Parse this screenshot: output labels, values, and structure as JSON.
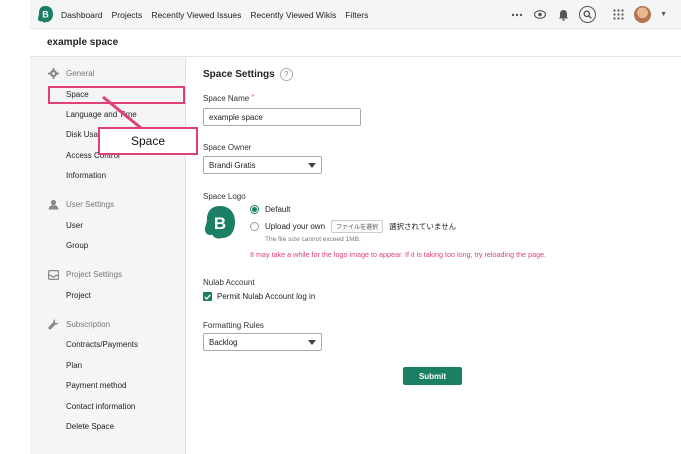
{
  "nav": {
    "items": [
      "Dashboard",
      "Projects",
      "Recently Viewed Issues",
      "Recently Viewed Wikis",
      "Filters"
    ],
    "icons": [
      "more-icon",
      "watch-icon",
      "bell-icon",
      "search-icon",
      "apps-grid-icon",
      "avatar"
    ]
  },
  "space_title": "example space",
  "sidebar": {
    "sections": [
      {
        "title": "General",
        "icon": "gear-icon",
        "items": [
          "Space",
          "Language and Time",
          "Disk Usage",
          "Access Control",
          "Information"
        ]
      },
      {
        "title": "User Settings",
        "icon": "users-icon",
        "items": [
          "User",
          "Group"
        ]
      },
      {
        "title": "Project Settings",
        "icon": "inbox-icon",
        "items": [
          "Project"
        ]
      },
      {
        "title": "Subscription",
        "icon": "wrench-icon",
        "items": [
          "Contracts/Payments",
          "Plan",
          "Payment method",
          "Contact information",
          "Delete Space"
        ]
      }
    ]
  },
  "callout": {
    "label": "Space",
    "accent": "#e0407a"
  },
  "form": {
    "title": "Space Settings",
    "help": "?",
    "space_name": {
      "label": "Space Name",
      "required_mark": "*",
      "value": "example space"
    },
    "space_owner": {
      "label": "Space Owner",
      "value": "Brandi Gratis"
    },
    "space_logo": {
      "label": "Space Logo",
      "option_default": "Default",
      "option_upload": "Upload your own",
      "file_button": "ファイルを選択",
      "file_status": "選択されていません",
      "hint": "The file size cannot exceed 1MB.",
      "warning": "It may take a while for the logo image to appear. If it is taking too long, try reloading the page."
    },
    "nulab": {
      "label": "Nulab Account",
      "checkbox": "Permit Nulab Account log in"
    },
    "formatting": {
      "label": "Formatting Rules",
      "value": "Backlog"
    },
    "submit": "Submit"
  },
  "colors": {
    "brand": "#1a7f64",
    "highlight": "#e0407a"
  }
}
